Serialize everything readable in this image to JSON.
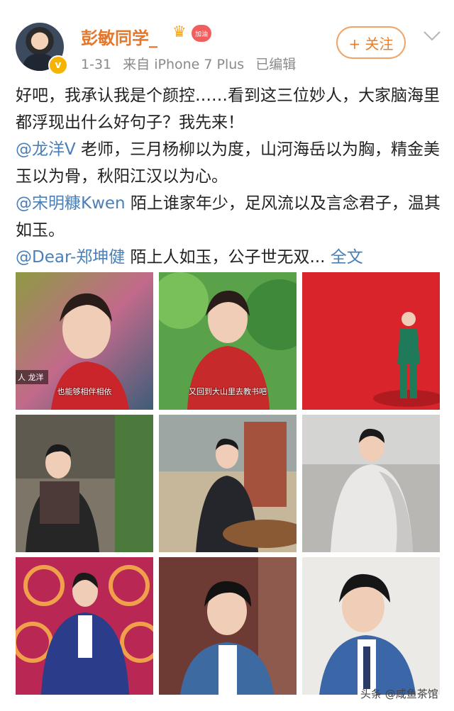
{
  "user": {
    "name": "彭敏同学_",
    "fan_badge": "加油",
    "verified_badge": "v"
  },
  "meta": {
    "date": "1-31",
    "source": "来自 iPhone 7 Plus",
    "edited": "已编辑"
  },
  "follow_label": "+ 关注",
  "post": {
    "intro": "好吧，我承认我是个颜控……看到这三位妙人，大家脑海里都浮现出什么好句子？我先来！",
    "p1_mention": "@龙洋V",
    "p1_text": " 老师，三月杨柳以为度，山河海岳以为胸，精金美玉以为骨，秋阳江汉以为心。",
    "p2_mention": "@宋明糠Kwen",
    "p2_text": " 陌上谁家年少，足风流以及言念君子，温其如玉。",
    "p3_mention": "@Dear-郑坤健",
    "p3_text": " 陌上人如玉，公子世无双...",
    "fulltext": " 全文"
  },
  "images": {
    "img1_caption": "也能够相伴相依",
    "img2_caption": "又回到大山里去教书吧",
    "img1_side_text": "人 龙洋"
  },
  "watermark": "头条 @咸鱼茶馆"
}
